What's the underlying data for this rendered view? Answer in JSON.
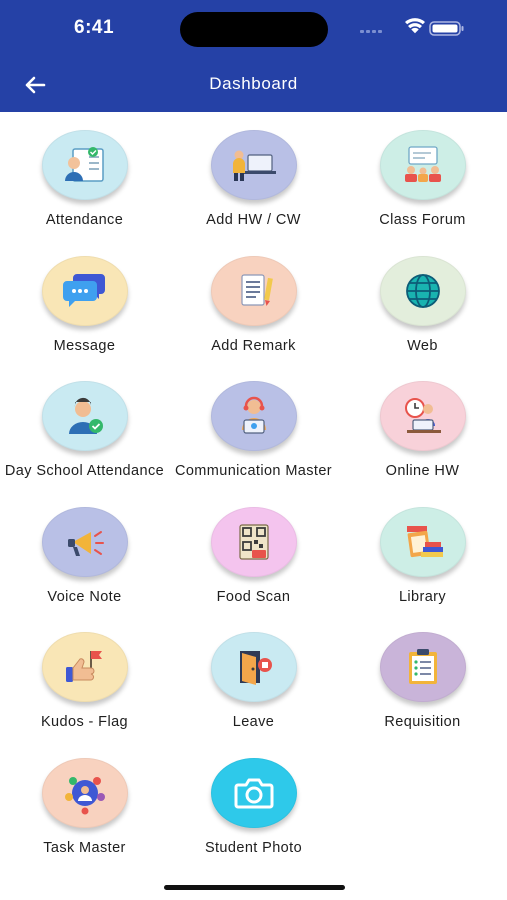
{
  "status_bar": {
    "time": "6:41"
  },
  "header": {
    "title": "Dashboard"
  },
  "colors": {
    "header_bg": "#2541a6",
    "disc_light_blue": "#c9eaf2",
    "disc_lavender": "#b9c0e6",
    "disc_mint": "#cdeee6",
    "disc_peach": "#f9e6b6",
    "disc_salmon": "#f8d2bf",
    "disc_pale_green": "#e3eedc",
    "disc_pink": "#f8d1d9",
    "disc_purple": "#c9b4d9",
    "disc_camera": "#2ec9ea"
  },
  "tiles": [
    {
      "label": "Attendance",
      "icon": "attendance-icon"
    },
    {
      "label": "Add HW / CW",
      "icon": "homework-icon"
    },
    {
      "label": "Class Forum",
      "icon": "class-forum-icon"
    },
    {
      "label": "Message",
      "icon": "message-icon"
    },
    {
      "label": "Add Remark",
      "icon": "remark-icon"
    },
    {
      "label": "Web",
      "icon": "globe-icon"
    },
    {
      "label": "Day School Attendance",
      "icon": "day-school-attendance-icon"
    },
    {
      "label": "Communication Master",
      "icon": "communication-icon"
    },
    {
      "label": "Online HW",
      "icon": "online-hw-icon"
    },
    {
      "label": "Voice Note",
      "icon": "megaphone-icon"
    },
    {
      "label": "Food Scan",
      "icon": "qr-food-icon"
    },
    {
      "label": "Library",
      "icon": "books-icon"
    },
    {
      "label": "Kudos - Flag",
      "icon": "thumbs-up-flag-icon"
    },
    {
      "label": "Leave",
      "icon": "door-exit-icon"
    },
    {
      "label": "Requisition",
      "icon": "clipboard-icon"
    },
    {
      "label": "Task Master",
      "icon": "task-network-icon"
    },
    {
      "label": "Student Photo",
      "icon": "camera-icon"
    }
  ]
}
